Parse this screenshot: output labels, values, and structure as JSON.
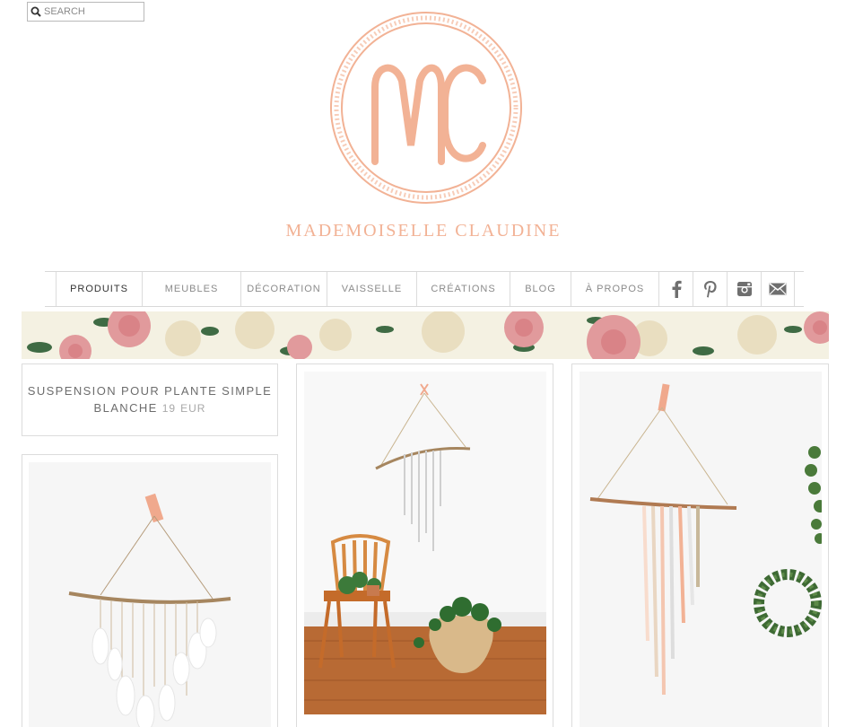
{
  "search": {
    "placeholder": "SEARCH"
  },
  "brand": {
    "monogram": "MC",
    "name": "MADEMOISELLE CLAUDINE",
    "color": "#f2b295"
  },
  "nav": {
    "items": [
      {
        "label": "PRODUITS",
        "active": true
      },
      {
        "label": "MEUBLES"
      },
      {
        "label": "DÉCORATION"
      },
      {
        "label": "VAISSELLE"
      },
      {
        "label": "CRÉATIONS"
      },
      {
        "label": "BLOG"
      },
      {
        "label": "À PROPOS"
      }
    ],
    "social": [
      "facebook-icon",
      "pinterest-icon",
      "instagram-icon",
      "mail-icon"
    ]
  },
  "products": [
    {
      "title": "SUSPENSION POUR PLANTE SIMPLE BLANCHE",
      "price": "19",
      "currency": "EUR"
    }
  ]
}
